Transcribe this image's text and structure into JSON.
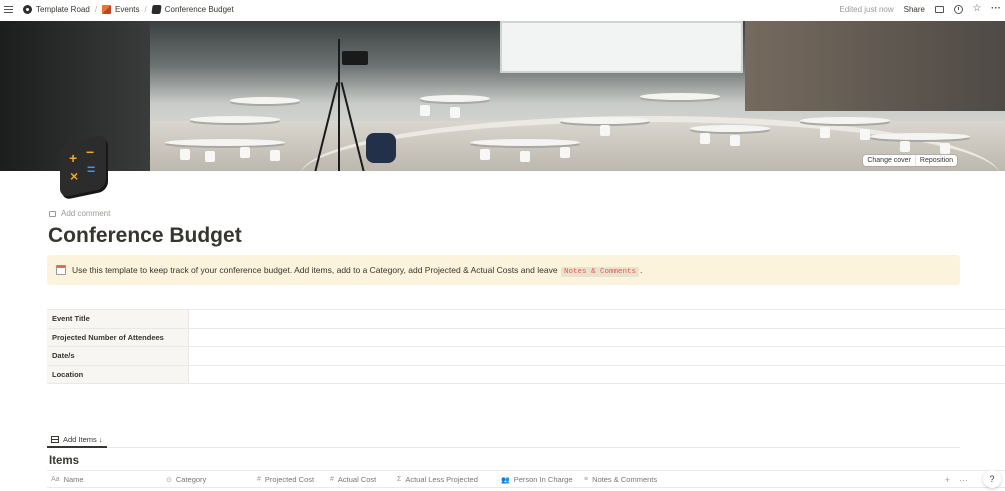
{
  "topbar": {
    "breadcrumbs": [
      {
        "label": "Template Road"
      },
      {
        "label": "Events"
      },
      {
        "label": "Conference Budget"
      }
    ],
    "separator": "/",
    "edited": "Edited just now",
    "share": "Share",
    "more": "···"
  },
  "cover": {
    "change_cover": "Change cover",
    "reposition": "Reposition"
  },
  "page_icon": {
    "glyphs": [
      "+",
      "−",
      "×",
      "="
    ],
    "colors": [
      "#f5a623",
      "#f5a623",
      "#f5a623",
      "#4a90e2"
    ]
  },
  "page": {
    "add_comment": "Add comment",
    "title": "Conference Budget",
    "callout": {
      "text": "Use this template to keep track of your conference budget. Add items, add to a Category, add Projected & Actual Costs and leave",
      "code": "Notes & Comments",
      "end": "."
    },
    "properties": [
      {
        "label": "Event Title",
        "value": ""
      },
      {
        "label": "Projected Number of Attendees",
        "value": ""
      },
      {
        "label": "Date/s",
        "value": ""
      },
      {
        "label": "Location",
        "value": ""
      }
    ]
  },
  "database": {
    "view_tab": "Add Items ↓",
    "title": "Items",
    "columns": [
      {
        "icon": "Aa",
        "label": "Name"
      },
      {
        "icon": "⊙",
        "label": "Category"
      },
      {
        "icon": "#",
        "label": "Projected Cost"
      },
      {
        "icon": "#",
        "label": "Actual Cost"
      },
      {
        "icon": "Σ",
        "label": "Actual Less Projected"
      },
      {
        "icon": "👥",
        "label": "Person In Charge"
      },
      {
        "icon": "≡",
        "label": "Notes & Comments"
      }
    ],
    "add": "+",
    "more": "···"
  },
  "help": "?"
}
